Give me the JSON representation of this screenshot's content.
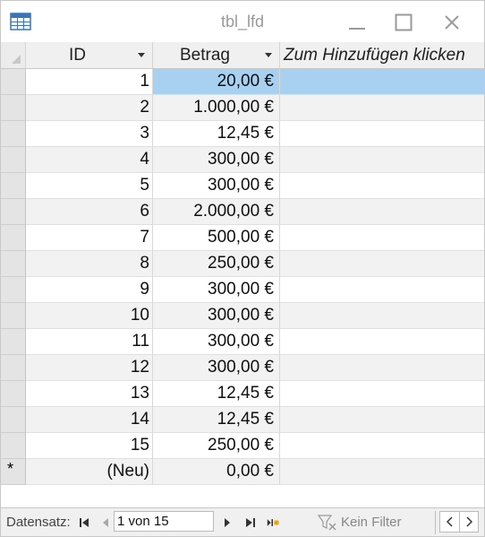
{
  "window": {
    "title": "tbl_lfd",
    "icon": "datasheet-table-icon",
    "controls": [
      "minimize-icon",
      "maximize-icon",
      "close-icon"
    ]
  },
  "table": {
    "columns": [
      {
        "label": "ID"
      },
      {
        "label": "Betrag"
      },
      {
        "label": "Zum Hinzufügen klicken"
      }
    ],
    "rows": [
      {
        "id": "1",
        "betrag": "20,00 €"
      },
      {
        "id": "2",
        "betrag": "1.000,00 €"
      },
      {
        "id": "3",
        "betrag": "12,45 €"
      },
      {
        "id": "4",
        "betrag": "300,00 €"
      },
      {
        "id": "5",
        "betrag": "300,00 €"
      },
      {
        "id": "6",
        "betrag": "2.000,00 €"
      },
      {
        "id": "7",
        "betrag": "500,00 €"
      },
      {
        "id": "8",
        "betrag": "250,00 €"
      },
      {
        "id": "9",
        "betrag": "300,00 €"
      },
      {
        "id": "10",
        "betrag": "300,00 €"
      },
      {
        "id": "11",
        "betrag": "300,00 €"
      },
      {
        "id": "12",
        "betrag": "300,00 €"
      },
      {
        "id": "13",
        "betrag": "12,45 €"
      },
      {
        "id": "14",
        "betrag": "12,45 €"
      },
      {
        "id": "15",
        "betrag": "250,00 €"
      }
    ],
    "new_row": {
      "id": "(Neu)",
      "betrag": "0,00 €",
      "marker": "*"
    },
    "selected_row": 0,
    "selection_color": "#a8d0f0"
  },
  "statusbar": {
    "label": "Datensatz:",
    "record": "1 von 15",
    "filter_label": "Kein Filter"
  }
}
